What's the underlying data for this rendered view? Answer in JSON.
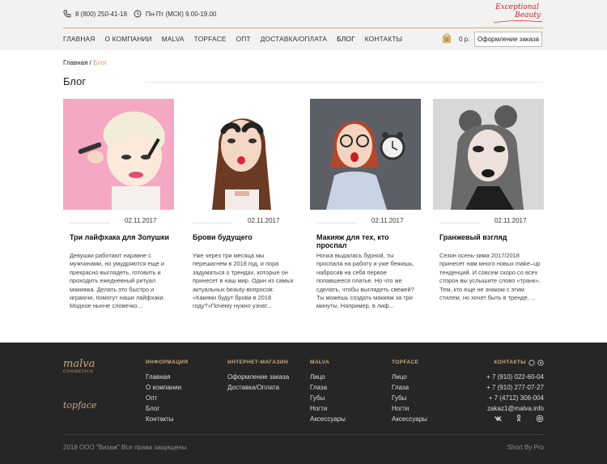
{
  "header": {
    "phone": "8 (800) 250-41-18",
    "hours": "Пн-Пт (МСК) 9.00-19.00",
    "logo_line1": "Exceptional",
    "logo_line2": "Beauty",
    "nav": [
      "Главная",
      "О компании",
      "MALVA",
      "TOPFACE",
      "Опт",
      "Доставка/Оплата",
      "Блог",
      "Контакты"
    ],
    "cart_count": "0",
    "cart_price": "0 р.",
    "order_button": "Оформление заказа",
    "accent": "#c9b27d"
  },
  "breadcrumbs": {
    "home": "Главная",
    "sep": " / ",
    "current": "Блог"
  },
  "page_title": "Блог",
  "posts": [
    {
      "date": "02.11.2017",
      "title": "Три лайфхака для Золушки",
      "excerpt": "Девушки работают наравне с мужчинами, но умудряются еще и прекрасно выглядеть, готовить и проходить ежедневный ритуал макияжа. Делать это быстро и играючи, помогут наши лайфхаки. Модное нынче словечко..."
    },
    {
      "date": "02.11.2017",
      "title": "Брови будущего",
      "excerpt": "Уже через три месяца мы перешагнем в 2018 год, и пора задуматься о трендах, которые он принесет в наш мир. Один из самых актуальных beauty-вопросов: «Какими будут брови в 2018 году?»Почему нужно узнат..."
    },
    {
      "date": "02.11.2017",
      "title": "Макияж для тех, кто проспал",
      "excerpt": "Ночка выдалась бурной, ты проспала на работу и уже бежишь, набросив на себя первое попавшееся платье. Но что же сделать, чтобы выглядеть свежей? Ты можешь создать макияж за три минуты. Например, в лиф..."
    },
    {
      "date": "02.11.2017",
      "title": "Гранжевый взгляд",
      "excerpt": "Сезон осень-зима 2017/2018 принесет нам много новых make–up тенденций. И совсем скоро со всех сторон вы услышите слово «транк». Тем, кто еще не знаком с этим стилем, но хочет быть в тренде, ..."
    }
  ],
  "footer": {
    "brand1": "malva",
    "brand1_sub": "COSMETICS",
    "brand2": "topface",
    "columns": [
      {
        "heading": "Информация",
        "items": [
          "Главная",
          "О компании",
          "Опт",
          "Блог",
          "Контакты"
        ]
      },
      {
        "heading": "Интернет-магазин",
        "items": [
          "Оформление заказа",
          "Доставка/Оплата"
        ]
      },
      {
        "heading": "Malva",
        "items": [
          "Лицо",
          "Глаза",
          "Губы",
          "Ногти",
          "Аксессуары"
        ]
      },
      {
        "heading": "Topface",
        "items": [
          "Лицо",
          "Глаза",
          "Губы",
          "Ногти",
          "Аксессуары"
        ]
      }
    ],
    "contacts_heading": "Контакты",
    "contacts": [
      "+ 7 (910) 022-60-04",
      "+ 7 (910) 277-07-27",
      "+ 7 (4712) 306-004",
      "zakaz1@malva.info"
    ],
    "socials": [
      "vk-icon",
      "odnoklassniki-icon",
      "instagram-icon"
    ],
    "copyright": "2018 ООО \"Визаж\" Все права защищены",
    "author": "Short By Pro"
  }
}
